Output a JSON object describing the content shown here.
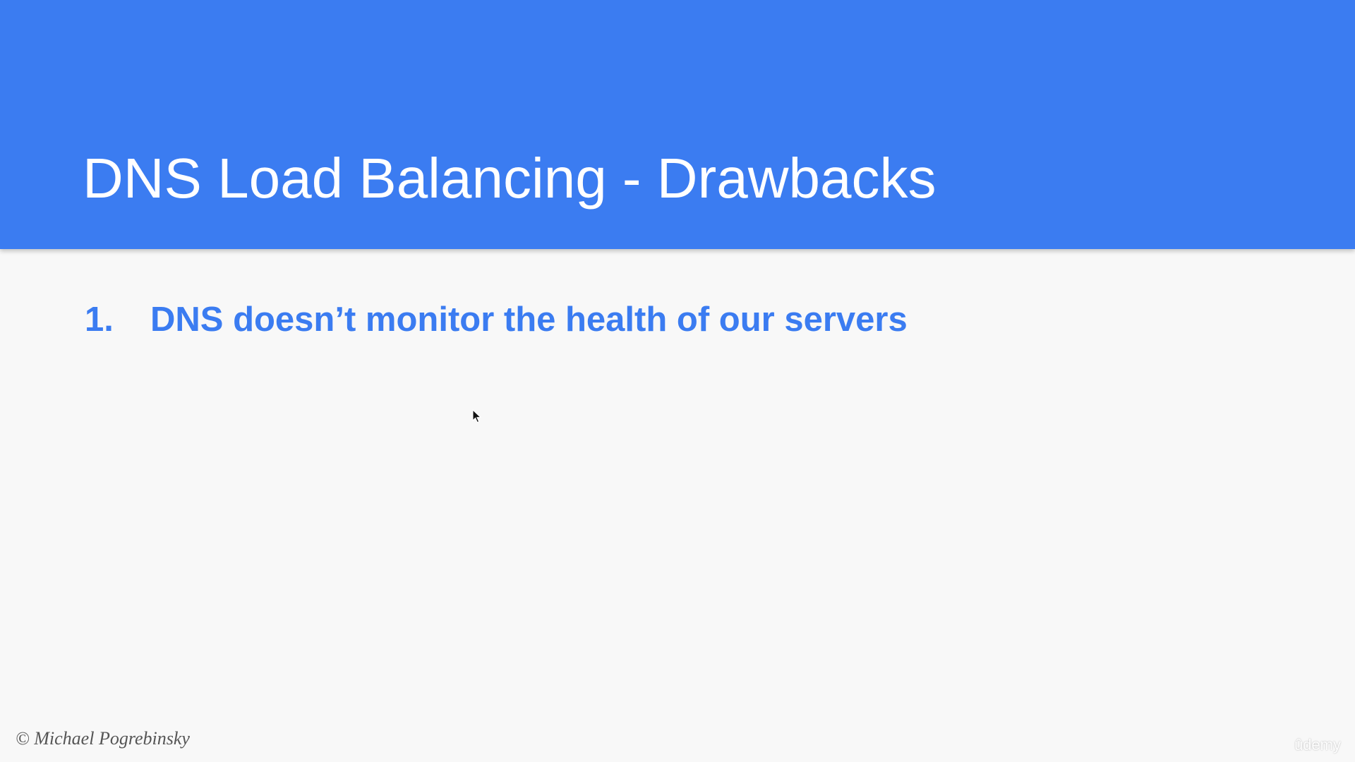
{
  "slide": {
    "title": "DNS Load Balancing - Drawbacks",
    "bullets": [
      {
        "number": "1.",
        "text": "DNS doesn’t monitor the health of our servers"
      }
    ],
    "copyright": "© Michael Pogrebinsky",
    "watermark": "ûdemy"
  },
  "colors": {
    "header_background": "#3b7cf1",
    "title_text": "#ffffff",
    "bullet_text": "#3b7cf1",
    "slide_background": "#f8f8f8"
  },
  "icons": {
    "cursor": "mouse-pointer-icon"
  }
}
